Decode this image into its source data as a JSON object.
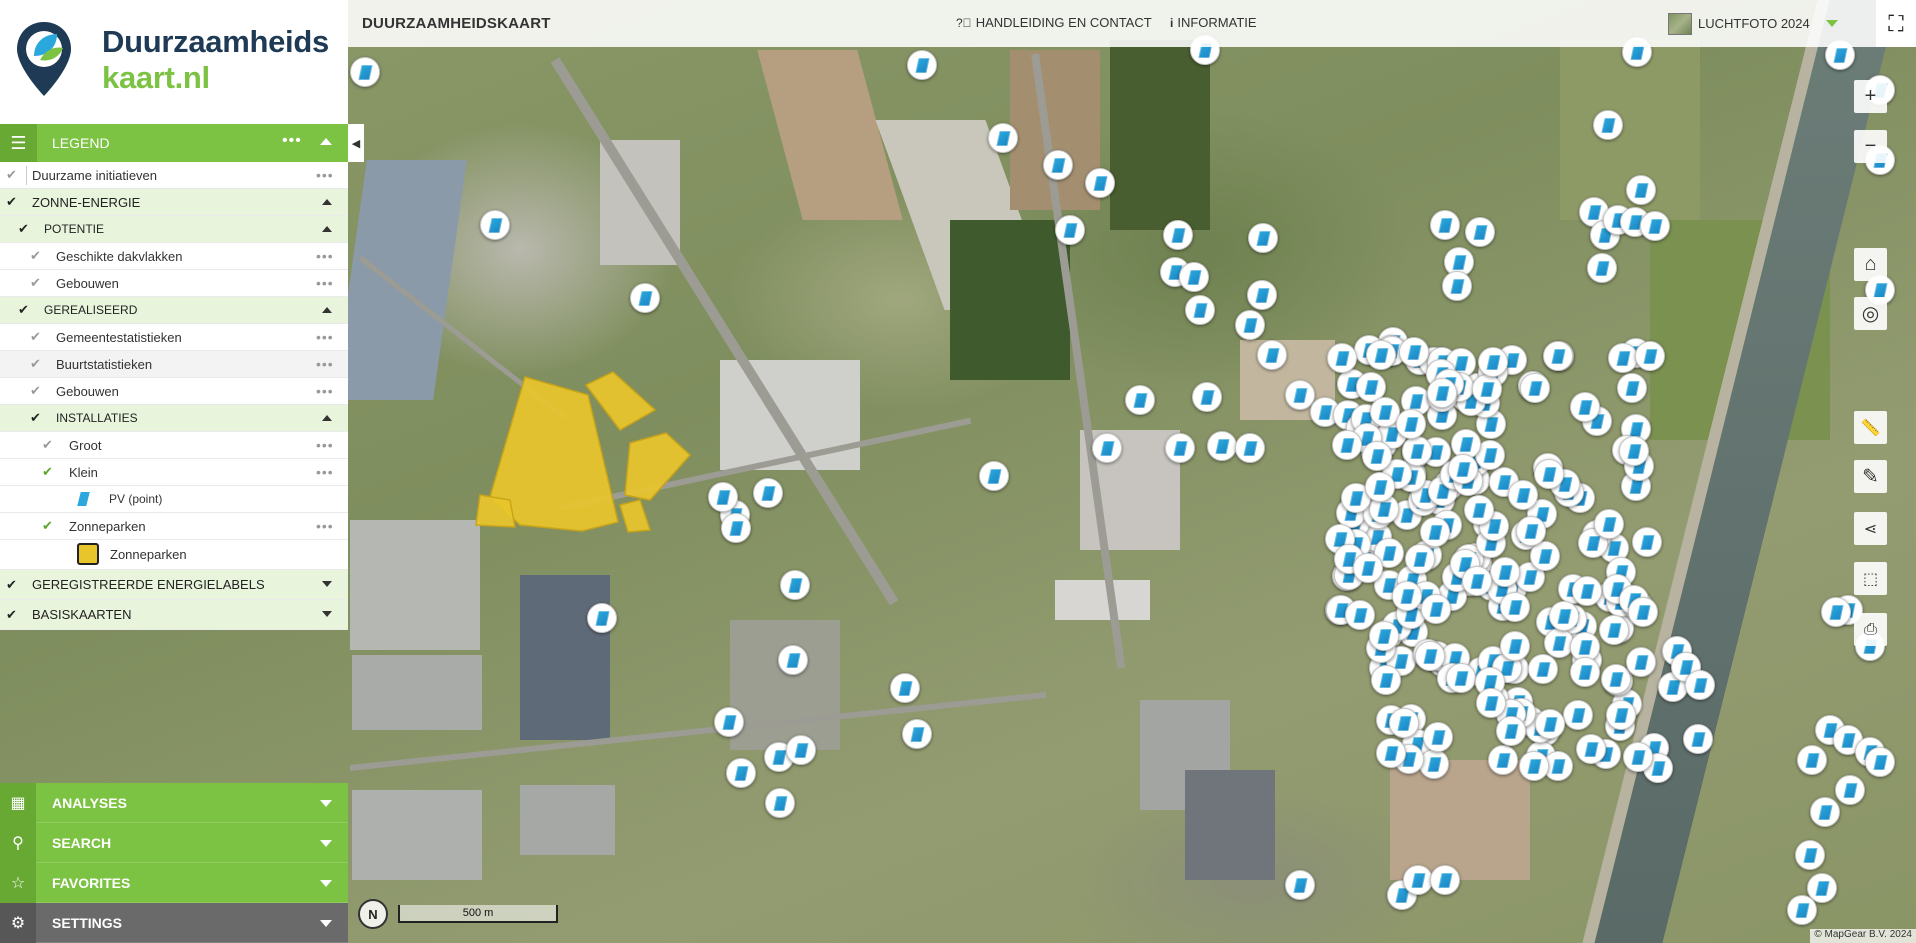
{
  "header": {
    "title": "DUURZAAMHEIDSKAART",
    "help_link": "HANDLEIDING EN CONTACT",
    "info_link": "INFORMATIE",
    "basemap_label": "LUCHTFOTO 2024"
  },
  "logo": {
    "line1": "Duurzaamheids",
    "line2": "kaart.nl"
  },
  "legend": {
    "title": "LEGEND",
    "dots": "•••",
    "items": [
      {
        "label": "Duurzame initiatieven"
      },
      {
        "label": "ZONNE-ENERGIE"
      },
      {
        "label": "POTENTIE"
      },
      {
        "label": "Geschikte dakvlakken"
      },
      {
        "label": "Gebouwen"
      },
      {
        "label": "GEREALISEERD"
      },
      {
        "label": "Gemeentestatistieken"
      },
      {
        "label": "Buurtstatistieken"
      },
      {
        "label": "Gebouwen"
      },
      {
        "label": "INSTALLATIES"
      },
      {
        "label": "Groot"
      },
      {
        "label": "Klein"
      },
      {
        "label": "PV (point)"
      },
      {
        "label": "Zonneparken"
      },
      {
        "label": "Zonneparken"
      },
      {
        "label": "GEREGISTREERDE ENERGIELABELS"
      },
      {
        "label": "BASISKAARTEN"
      }
    ]
  },
  "bottom_menu": {
    "analyses": "ANALYSES",
    "search": "SEARCH",
    "favorites": "FAVORITES",
    "settings": "SETTINGS"
  },
  "map": {
    "scale_label": "500 m",
    "north_label": "N",
    "attribution": "© MapGear B.V. 2024"
  },
  "colors": {
    "brand_green": "#7cc243",
    "brand_navy": "#1e3a55",
    "zonnepark_fill": "#e9c52c",
    "pv_blue": "#2aa8dd"
  },
  "icons": {
    "legend_menu": "hamburger-icon",
    "help": "question-circle-icon",
    "info": "info-icon",
    "fullscreen": "fullscreen-icon",
    "zoom_in": "plus-icon",
    "zoom_out": "minus-icon",
    "home": "home-icon",
    "locate": "locate-icon",
    "measure": "ruler-icon",
    "draw": "pencil-icon",
    "share": "share-icon",
    "screenshot": "screenshot-icon",
    "print": "print-icon"
  }
}
